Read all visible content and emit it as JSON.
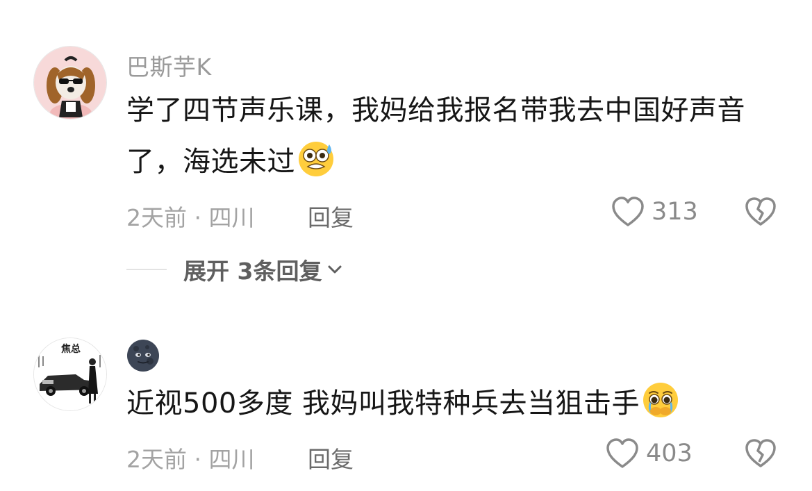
{
  "comments": [
    {
      "username": "巴斯芋K",
      "text": "学了四节声乐课，我妈给我报名带我去中国好声音了，海选未过",
      "emoji": "anxious-sweat-emoji",
      "time": "2天前",
      "separator": "·",
      "location": "四川",
      "reply_label": "回复",
      "likes": "313",
      "expand_replies": "展开 3条回复"
    },
    {
      "username": "",
      "username_emoji": "new-moon-face-emoji",
      "avatar_caption": "焦总",
      "text": "近视500多度 我妈叫我特种兵去当狙击手",
      "emoji": "pleading-crying-emoji",
      "time": "2天前",
      "separator": "·",
      "location": "四川",
      "reply_label": "回复",
      "likes": "403"
    }
  ],
  "icons": {
    "like": "heart-outline-icon",
    "dislike": "broken-heart-icon",
    "expand": "chevron-down-icon"
  },
  "colors": {
    "text": "#161616",
    "secondary": "#9a9a9a",
    "icon": "#8a8a8a"
  }
}
